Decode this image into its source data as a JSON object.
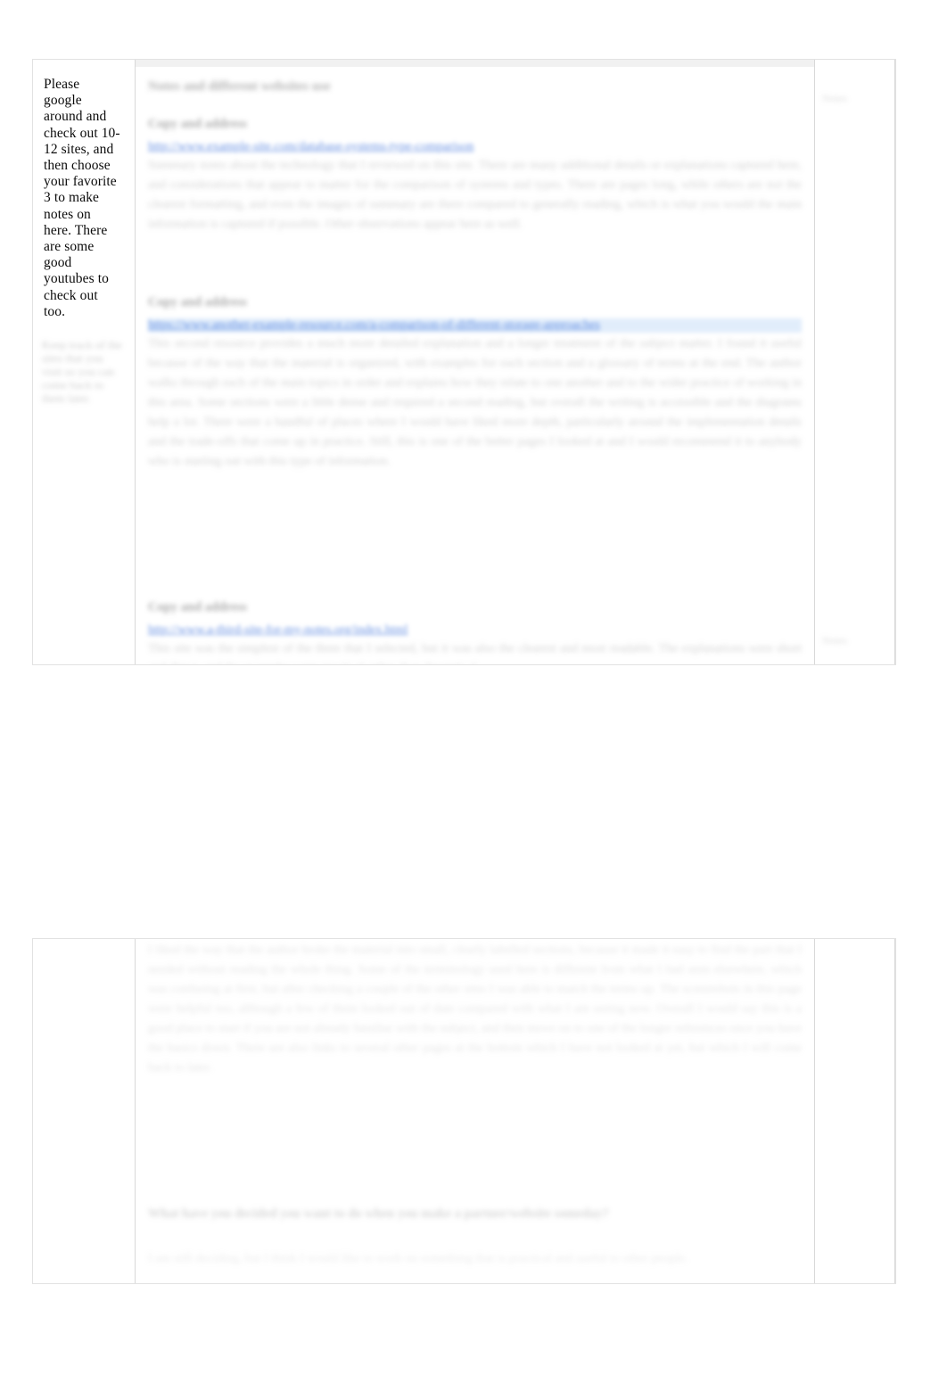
{
  "page1": {
    "left_column": {
      "instruction": "Please google around and check out 10-12 sites, and then choose your favorite 3 to make notes on here. There are some good youtubes to check out too.",
      "secondary_note": "Keep track of the sites that you visit so you can come back to them later."
    },
    "main": {
      "heading": "Notes and different websites use",
      "entries": [
        {
          "label": "Copy and address",
          "url": "http://www.example-site.com/database-systems-type-comparison",
          "notes": "Summary notes about the technology that I reviewed on this site. There are many additional details or explanations captured here, and considerations that appear to matter for the comparison of systems and types. There are pages long, while others are not the clearest formatting, and even the images of summary are there compared to generally reading, which is what you would the main information is captured if possible. Other observations appear here as well."
        },
        {
          "label": "Copy and address",
          "url": "https://www.another-example-resource.com/a-comparison-of-different-storage-approaches",
          "notes": "This second resource provides a much more detailed explanation and a longer treatment of the subject matter. I found it useful because of the way that the material is organized, with examples for each section and a glossary of terms at the end. The author walks through each of the main topics in order and explains how they relate to one another and to the wider practice of working in this area. Some sections were a little dense and required a second reading, but overall the writing is accessible and the diagrams help a lot. There were a handful of places where I would have liked more depth, particularly around the implementation details and the trade-offs that come up in practice. Still, this is one of the better pages I looked at and I would recommend it to anybody who is starting out with this type of information."
        },
        {
          "label": "Copy and address",
          "url": "http://www.a-third-site-for-my-notes.org/index.html",
          "notes": "This site was the simplest of the three that I selected, but it was also the clearest and most readable. The explanations were short and direct, and the examples were practical rather than theoretical."
        }
      ]
    },
    "right_column": {
      "top_mark": "Notes",
      "bottom_mark": "Notes"
    }
  },
  "page2": {
    "main": {
      "continued_notes": "I liked the way that the author broke the material into small, clearly labelled sections, because it made it easy to find the part that I needed without reading the whole thing. Some of the terminology used here is different from what I had seen elsewhere, which was confusing at first, but after checking a couple of the other sites I was able to match the terms up. The screenshots in this page were helpful too, although a few of them looked out of date compared with what I am seeing now. Overall I would say this is a good place to start if you are not already familiar with the subject, and then move on to one of the longer references once you have the basics down. There are also links to several other pages at the bottom which I have not looked at yet, but which I will come back to later.",
      "question_heading": "What have you decided you want to do when you make a partner/website someday?",
      "answer_text": "I am still deciding, but I think I would like to work on something that is practical and useful to other people."
    }
  },
  "colors": {
    "page_background": "#ffffff",
    "canvas_background": "#ffffff",
    "page_border": "#e2e2e2",
    "table_border": "#d8d8d8",
    "link": "#245ed6",
    "link_highlight": "#c8def8",
    "body_text": "#0a0a0a"
  }
}
